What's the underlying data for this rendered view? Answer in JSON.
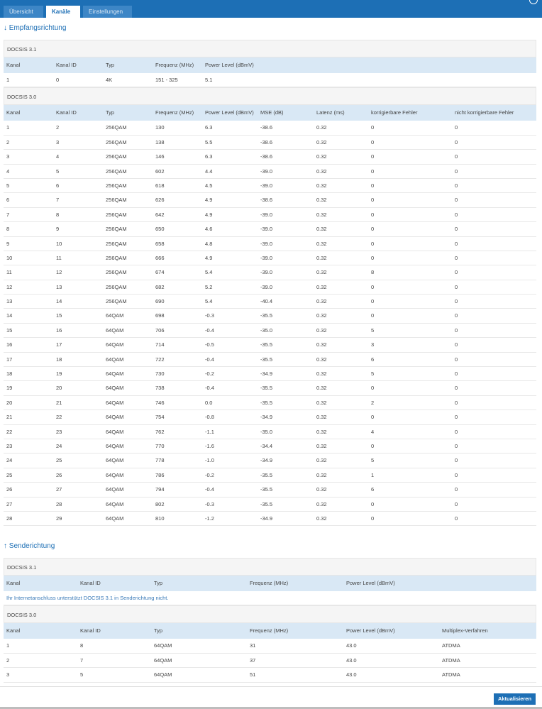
{
  "tabs": [
    "Übersicht",
    "Kanäle",
    "Einstellungen"
  ],
  "downstream": {
    "title": "↓ Empfangsrichtung",
    "docsis31": {
      "label": "DOCSIS 3.1",
      "columns": [
        "Kanal",
        "Kanal ID",
        "Typ",
        "Frequenz (MHz)",
        "Power Level (dBmV)"
      ],
      "rows": [
        [
          "1",
          "0",
          "4K",
          "151 - 325",
          "5.1"
        ]
      ]
    },
    "docsis30": {
      "label": "DOCSIS 3.0",
      "columns": [
        "Kanal",
        "Kanal ID",
        "Typ",
        "Frequenz (MHz)",
        "Power Level (dBmV)",
        "MSE (dB)",
        "Latenz (ms)",
        "korrigierbare Fehler",
        "nicht korrigierbare Fehler"
      ],
      "rows": [
        [
          "1",
          "2",
          "256QAM",
          "130",
          "6.3",
          "-38.6",
          "0.32",
          "0",
          "0"
        ],
        [
          "2",
          "3",
          "256QAM",
          "138",
          "5.5",
          "-38.6",
          "0.32",
          "0",
          "0"
        ],
        [
          "3",
          "4",
          "256QAM",
          "146",
          "6.3",
          "-38.6",
          "0.32",
          "0",
          "0"
        ],
        [
          "4",
          "5",
          "256QAM",
          "602",
          "4.4",
          "-39.0",
          "0.32",
          "0",
          "0"
        ],
        [
          "5",
          "6",
          "256QAM",
          "618",
          "4.5",
          "-39.0",
          "0.32",
          "0",
          "0"
        ],
        [
          "6",
          "7",
          "256QAM",
          "626",
          "4.9",
          "-38.6",
          "0.32",
          "0",
          "0"
        ],
        [
          "7",
          "8",
          "256QAM",
          "642",
          "4.9",
          "-39.0",
          "0.32",
          "0",
          "0"
        ],
        [
          "8",
          "9",
          "256QAM",
          "650",
          "4.6",
          "-39.0",
          "0.32",
          "0",
          "0"
        ],
        [
          "9",
          "10",
          "256QAM",
          "658",
          "4.8",
          "-39.0",
          "0.32",
          "0",
          "0"
        ],
        [
          "10",
          "11",
          "256QAM",
          "666",
          "4.9",
          "-39.0",
          "0.32",
          "0",
          "0"
        ],
        [
          "11",
          "12",
          "256QAM",
          "674",
          "5.4",
          "-39.0",
          "0.32",
          "8",
          "0"
        ],
        [
          "12",
          "13",
          "256QAM",
          "682",
          "5.2",
          "-39.0",
          "0.32",
          "0",
          "0"
        ],
        [
          "13",
          "14",
          "256QAM",
          "690",
          "5.4",
          "-40.4",
          "0.32",
          "0",
          "0"
        ],
        [
          "14",
          "15",
          "64QAM",
          "698",
          "-0.3",
          "-35.5",
          "0.32",
          "0",
          "0"
        ],
        [
          "15",
          "16",
          "64QAM",
          "706",
          "-0.4",
          "-35.0",
          "0.32",
          "5",
          "0"
        ],
        [
          "16",
          "17",
          "64QAM",
          "714",
          "-0.5",
          "-35.5",
          "0.32",
          "3",
          "0"
        ],
        [
          "17",
          "18",
          "64QAM",
          "722",
          "-0.4",
          "-35.5",
          "0.32",
          "6",
          "0"
        ],
        [
          "18",
          "19",
          "64QAM",
          "730",
          "-0.2",
          "-34.9",
          "0.32",
          "5",
          "0"
        ],
        [
          "19",
          "20",
          "64QAM",
          "738",
          "-0.4",
          "-35.5",
          "0.32",
          "0",
          "0"
        ],
        [
          "20",
          "21",
          "64QAM",
          "746",
          "0.0",
          "-35.5",
          "0.32",
          "2",
          "0"
        ],
        [
          "21",
          "22",
          "64QAM",
          "754",
          "-0.8",
          "-34.9",
          "0.32",
          "0",
          "0"
        ],
        [
          "22",
          "23",
          "64QAM",
          "762",
          "-1.1",
          "-35.0",
          "0.32",
          "4",
          "0"
        ],
        [
          "23",
          "24",
          "64QAM",
          "770",
          "-1.6",
          "-34.4",
          "0.32",
          "0",
          "0"
        ],
        [
          "24",
          "25",
          "64QAM",
          "778",
          "-1.0",
          "-34.9",
          "0.32",
          "5",
          "0"
        ],
        [
          "25",
          "26",
          "64QAM",
          "786",
          "-0.2",
          "-35.5",
          "0.32",
          "1",
          "0"
        ],
        [
          "26",
          "27",
          "64QAM",
          "794",
          "-0.4",
          "-35.5",
          "0.32",
          "6",
          "0"
        ],
        [
          "27",
          "28",
          "64QAM",
          "802",
          "-0.3",
          "-35.5",
          "0.32",
          "0",
          "0"
        ],
        [
          "28",
          "29",
          "64QAM",
          "810",
          "-1.2",
          "-34.9",
          "0.32",
          "0",
          "0"
        ]
      ]
    }
  },
  "upstream": {
    "title": "↑ Senderichtung",
    "docsis31": {
      "label": "DOCSIS 3.1",
      "columns": [
        "Kanal",
        "Kanal ID",
        "Typ",
        "Frequenz (MHz)",
        "Power Level (dBmV)"
      ],
      "note": "Ihr Internetanschluss unterstützt DOCSIS 3.1 in Senderichtung nicht."
    },
    "docsis30": {
      "label": "DOCSIS 3.0",
      "columns": [
        "Kanal",
        "Kanal ID",
        "Typ",
        "Frequenz (MHz)",
        "Power Level (dBmV)",
        "Multiplex-Verfahren"
      ],
      "rows": [
        [
          "1",
          "8",
          "64QAM",
          "31",
          "43.0",
          "ATDMA"
        ],
        [
          "2",
          "7",
          "64QAM",
          "37",
          "43.0",
          "ATDMA"
        ],
        [
          "3",
          "5",
          "64QAM",
          "51",
          "43.0",
          "ATDMA"
        ]
      ]
    }
  },
  "footer": {
    "refresh_label": "Aktualisieren"
  },
  "colors": {
    "accent": "#1d6fb5",
    "header_row": "#d9e8f5",
    "group_row": "#f5f5f5"
  }
}
